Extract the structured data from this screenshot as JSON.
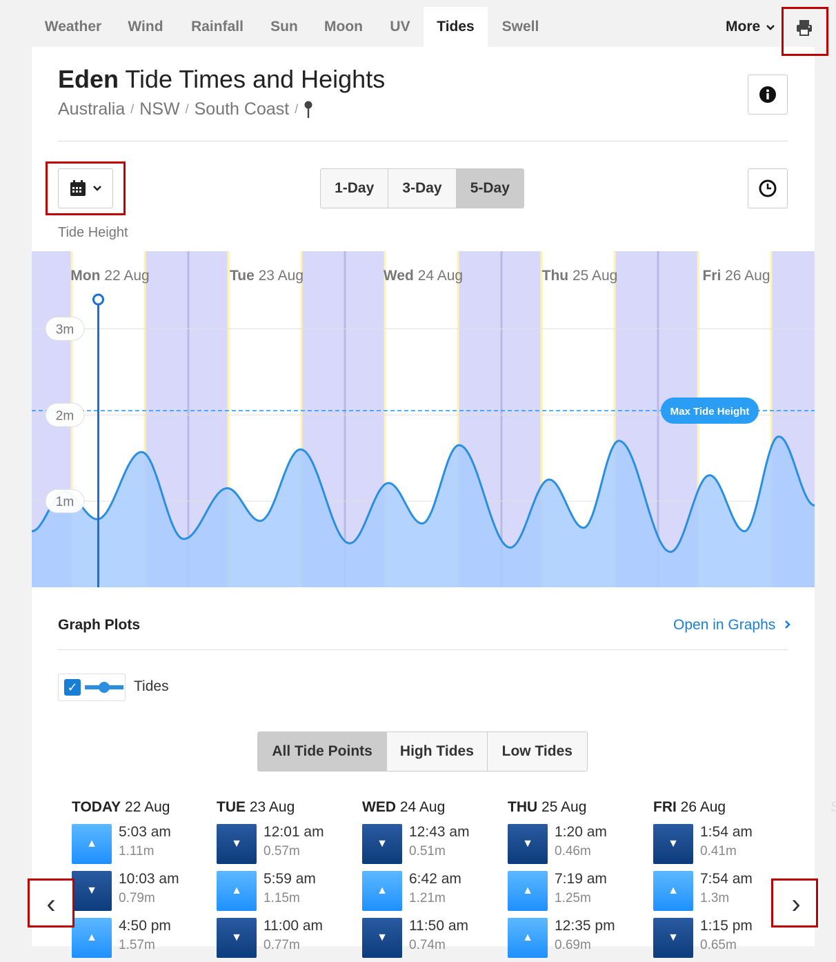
{
  "nav": {
    "tabs": [
      {
        "label": "Weather",
        "active": false
      },
      {
        "label": "Wind",
        "active": false
      },
      {
        "label": "Rainfall",
        "active": false
      },
      {
        "label": "Sun",
        "active": false
      },
      {
        "label": "Moon",
        "active": false
      },
      {
        "label": "UV",
        "active": false
      },
      {
        "label": "Tides",
        "active": true
      },
      {
        "label": "Swell",
        "active": false
      }
    ],
    "more_label": "More",
    "print_icon": "printer-icon"
  },
  "header": {
    "title_bold": "Eden",
    "title_rest": " Tide Times and Heights",
    "breadcrumb": [
      "Australia",
      "NSW",
      "South Coast"
    ],
    "breadcrumb_sep": "/",
    "info_icon": "info-icon"
  },
  "controls": {
    "calendar_icon": "calendar-icon",
    "range_options": [
      {
        "label": "1-Day",
        "active": false
      },
      {
        "label": "3-Day",
        "active": false
      },
      {
        "label": "5-Day",
        "active": true
      }
    ],
    "clock_icon": "clock-icon"
  },
  "chart_data": {
    "type": "area",
    "ylabel": "Tide Height",
    "title": "",
    "day_labels": [
      {
        "dow": "Mon",
        "date": "22 Aug"
      },
      {
        "dow": "Tue",
        "date": "23 Aug"
      },
      {
        "dow": "Wed",
        "date": "24 Aug"
      },
      {
        "dow": "Thu",
        "date": "25 Aug"
      },
      {
        "dow": "Fri",
        "date": "26 Aug"
      }
    ],
    "y_ticks": [
      "3m",
      "2m",
      "1m"
    ],
    "y_tick_values": [
      3,
      2,
      1
    ],
    "ylim": [
      0,
      3.9
    ],
    "x_unit": "hours since Mon 22 Aug 00:00",
    "xlim": [
      0,
      120
    ],
    "max_line": {
      "label": "Max Tide Height",
      "value": 2.05
    },
    "now_marker_hours": 10.2,
    "series": [
      {
        "name": "Tides",
        "points": [
          [
            0,
            0.65
          ],
          [
            5.05,
            1.11
          ],
          [
            10.05,
            0.79
          ],
          [
            16.83,
            1.57
          ],
          [
            23.3,
            0.56
          ],
          [
            29.98,
            1.15
          ],
          [
            35.0,
            0.77
          ],
          [
            41.2,
            1.6
          ],
          [
            48.72,
            0.51
          ],
          [
            54.7,
            1.21
          ],
          [
            59.83,
            0.74
          ],
          [
            65.5,
            1.65
          ],
          [
            73.33,
            0.46
          ],
          [
            79.32,
            1.25
          ],
          [
            84.58,
            0.69
          ],
          [
            90.0,
            1.7
          ],
          [
            97.9,
            0.41
          ],
          [
            103.9,
            1.3
          ],
          [
            109.25,
            0.65
          ],
          [
            114.5,
            1.75
          ],
          [
            120,
            0.95
          ]
        ]
      }
    ],
    "night_bands": [
      [
        0,
        6
      ],
      [
        17.5,
        30
      ],
      [
        41.5,
        54
      ],
      [
        65.5,
        78
      ],
      [
        89.5,
        102
      ],
      [
        113.5,
        120
      ]
    ],
    "colors": {
      "night": "#d8d8fb",
      "day": "#ffffff",
      "twilight": "#fff3b0",
      "fill_dark": "#a8cbff",
      "fill_light": "#c8e6ff",
      "line": "#2a8fe0",
      "grid": "#e0e0e0",
      "max": "#2a9df4"
    }
  },
  "plots": {
    "heading": "Graph Plots",
    "open_link": "Open in Graphs",
    "open_icon": "chevron-right-icon",
    "legend_label": "Tides",
    "checked": true
  },
  "filter": {
    "options": [
      {
        "label": "All Tide Points",
        "active": true
      },
      {
        "label": "High Tides",
        "active": false
      },
      {
        "label": "Low Tides",
        "active": false
      }
    ]
  },
  "days": [
    {
      "dow": "TODAY",
      "date": "22 Aug",
      "tides": [
        {
          "type": "high",
          "time": "5:03 am",
          "height": "1.11m"
        },
        {
          "type": "low",
          "time": "10:03 am",
          "height": "0.79m"
        },
        {
          "type": "high",
          "time": "4:50 pm",
          "height": "1.57m"
        }
      ]
    },
    {
      "dow": "TUE",
      "date": "23 Aug",
      "tides": [
        {
          "type": "low",
          "time": "12:01 am",
          "height": "0.57m"
        },
        {
          "type": "high",
          "time": "5:59 am",
          "height": "1.15m"
        },
        {
          "type": "low",
          "time": "11:00 am",
          "height": "0.77m"
        }
      ]
    },
    {
      "dow": "WED",
      "date": "24 Aug",
      "tides": [
        {
          "type": "low",
          "time": "12:43 am",
          "height": "0.51m"
        },
        {
          "type": "high",
          "time": "6:42 am",
          "height": "1.21m"
        },
        {
          "type": "low",
          "time": "11:50 am",
          "height": "0.74m"
        }
      ]
    },
    {
      "dow": "THU",
      "date": "25 Aug",
      "tides": [
        {
          "type": "low",
          "time": "1:20 am",
          "height": "0.46m"
        },
        {
          "type": "high",
          "time": "7:19 am",
          "height": "1.25m"
        },
        {
          "type": "high",
          "time": "12:35 pm",
          "height": "0.69m"
        }
      ]
    },
    {
      "dow": "FRI",
      "date": "26 Aug",
      "tides": [
        {
          "type": "low",
          "time": "1:54 am",
          "height": "0.41m"
        },
        {
          "type": "high",
          "time": "7:54 am",
          "height": "1.3m"
        },
        {
          "type": "low",
          "time": "1:15 pm",
          "height": "0.65m"
        }
      ]
    }
  ],
  "ghost_day": "SA",
  "pager": {
    "prev": "‹",
    "next": "›"
  }
}
